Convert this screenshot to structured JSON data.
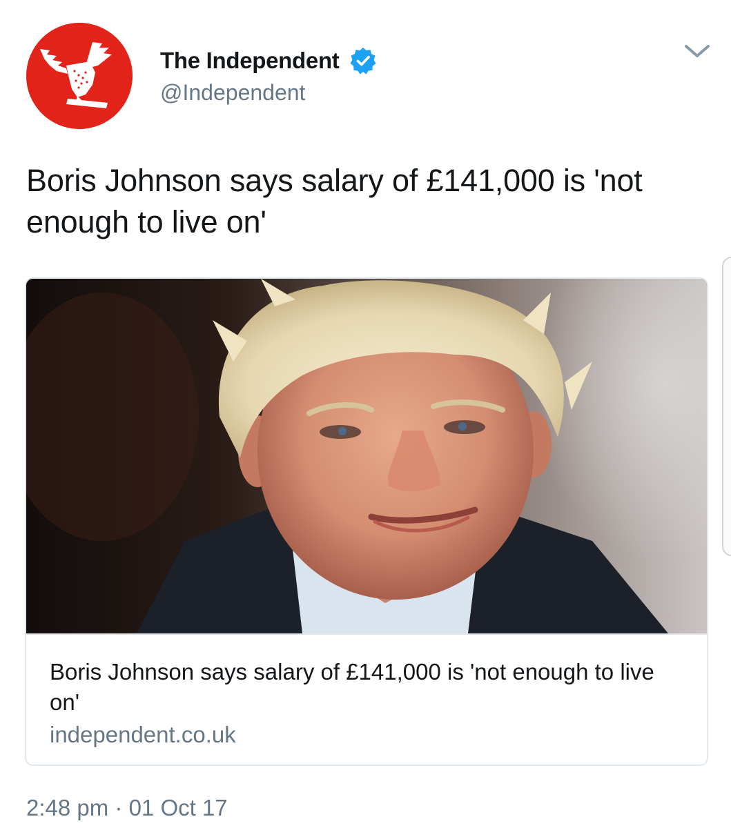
{
  "author": {
    "display_name": "The Independent",
    "handle": "@Independent",
    "verified": true,
    "avatar_icon": "eagle-logo-icon",
    "avatar_color": "#e2231a"
  },
  "tweet": {
    "text": "Boris Johnson says salary of £141,000 is 'not enough to live on'",
    "timestamp": "2:48 pm · 01 Oct 17"
  },
  "card": {
    "title": "Boris Johnson says salary of £141,000 is 'not enough to live on'",
    "domain": "independent.co.uk",
    "image_icon": "article-photo"
  },
  "colors": {
    "text": "#14171a",
    "secondary": "#657786",
    "verified_blue": "#1da1f2",
    "border": "#e1e8ed"
  },
  "icons": {
    "menu": "chevron-down-icon",
    "verified": "verified-badge-icon"
  }
}
